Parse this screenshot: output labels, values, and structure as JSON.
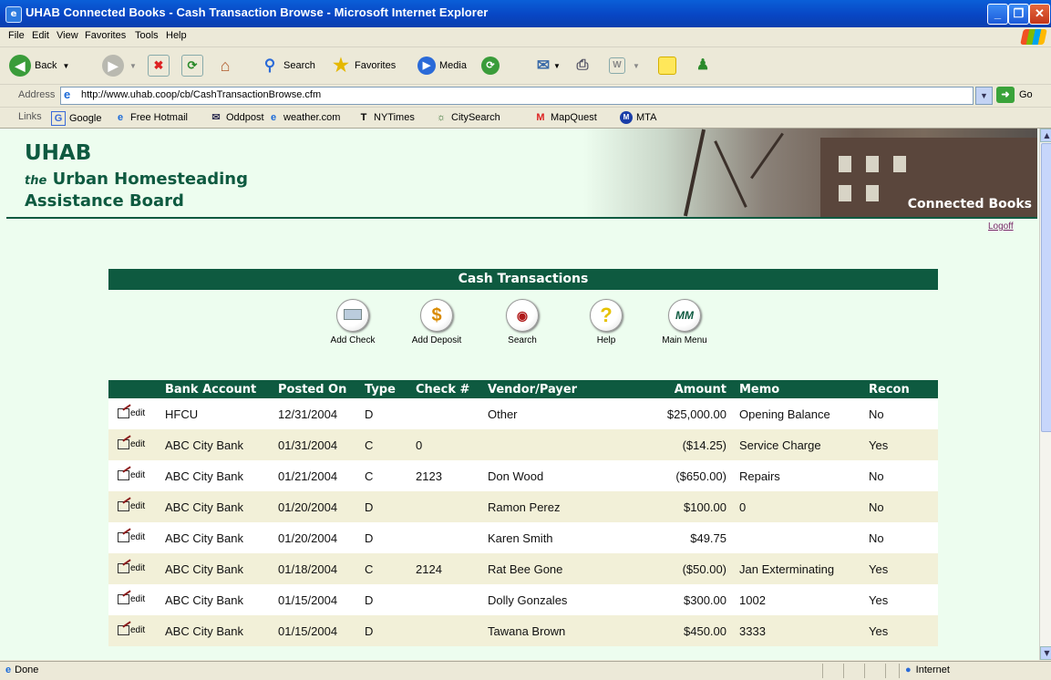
{
  "window": {
    "title": "UHAB Connected Books - Cash Transaction Browse - Microsoft Internet Explorer",
    "controls": [
      "_",
      "❐",
      "✕"
    ]
  },
  "menu": [
    "File",
    "Edit",
    "View",
    "Favorites",
    "Tools",
    "Help"
  ],
  "toolbar": {
    "back": "Back",
    "search": "Search",
    "favorites": "Favorites",
    "media": "Media"
  },
  "address": {
    "label": "Address",
    "url": "http://www.uhab.coop/cb/CashTransactionBrowse.cfm",
    "go": "Go"
  },
  "links": {
    "label": "Links",
    "items": [
      "Google",
      "Free Hotmail",
      "Oddpost",
      "weather.com",
      "NYTimes",
      "CitySearch",
      "MapQuest",
      "MTA"
    ]
  },
  "banner": {
    "logo_main": "UHAB",
    "logo_the": "the",
    "logo_line2": "Urban Homesteading",
    "logo_line3": "Assistance Board",
    "product": "Connected Books",
    "logoff": "Logoff"
  },
  "panel": {
    "title": "Cash Transactions",
    "actions": [
      {
        "label": "Add Check",
        "icon": "check-icon"
      },
      {
        "label": "Add Deposit",
        "icon": "dollar-icon"
      },
      {
        "label": "Search",
        "icon": "eye-icon"
      },
      {
        "label": "Help",
        "icon": "question-icon"
      },
      {
        "label": "Main Menu",
        "icon": "mm-icon",
        "glyph": "MM"
      }
    ]
  },
  "table": {
    "edit_label": "edit",
    "columns": [
      "",
      "Bank Account",
      "Posted On",
      "Type",
      "Check #",
      "Vendor/Payer",
      "Amount",
      "Memo",
      "Recon"
    ],
    "rows": [
      {
        "bank": "HFCU",
        "posted": "12/31/2004",
        "type": "D",
        "check": "",
        "vendor": "Other",
        "amount": "$25,000.00",
        "memo": "Opening Balance",
        "recon": "No"
      },
      {
        "bank": "ABC City Bank",
        "posted": "01/31/2004",
        "type": "C",
        "check": "0",
        "vendor": "",
        "amount": "($14.25)",
        "memo": "Service Charge",
        "recon": "Yes"
      },
      {
        "bank": "ABC City Bank",
        "posted": "01/21/2004",
        "type": "C",
        "check": "2123",
        "vendor": "Don Wood",
        "amount": "($650.00)",
        "memo": "Repairs",
        "recon": "No"
      },
      {
        "bank": "ABC City Bank",
        "posted": "01/20/2004",
        "type": "D",
        "check": "",
        "vendor": "Ramon Perez",
        "amount": "$100.00",
        "memo": "0",
        "recon": "No"
      },
      {
        "bank": "ABC City Bank",
        "posted": "01/20/2004",
        "type": "D",
        "check": "",
        "vendor": "Karen Smith",
        "amount": "$49.75",
        "memo": "",
        "recon": "No"
      },
      {
        "bank": "ABC City Bank",
        "posted": "01/18/2004",
        "type": "C",
        "check": "2124",
        "vendor": "Rat Bee Gone",
        "amount": "($50.00)",
        "memo": "Jan Exterminating",
        "recon": "Yes"
      },
      {
        "bank": "ABC City Bank",
        "posted": "01/15/2004",
        "type": "D",
        "check": "",
        "vendor": "Dolly Gonzales",
        "amount": "$300.00",
        "memo": "1002",
        "recon": "Yes"
      },
      {
        "bank": "ABC City Bank",
        "posted": "01/15/2004",
        "type": "D",
        "check": "",
        "vendor": "Tawana Brown",
        "amount": "$450.00",
        "memo": "3333",
        "recon": "Yes"
      }
    ]
  },
  "status": {
    "left": "Done",
    "zone": "Internet"
  }
}
